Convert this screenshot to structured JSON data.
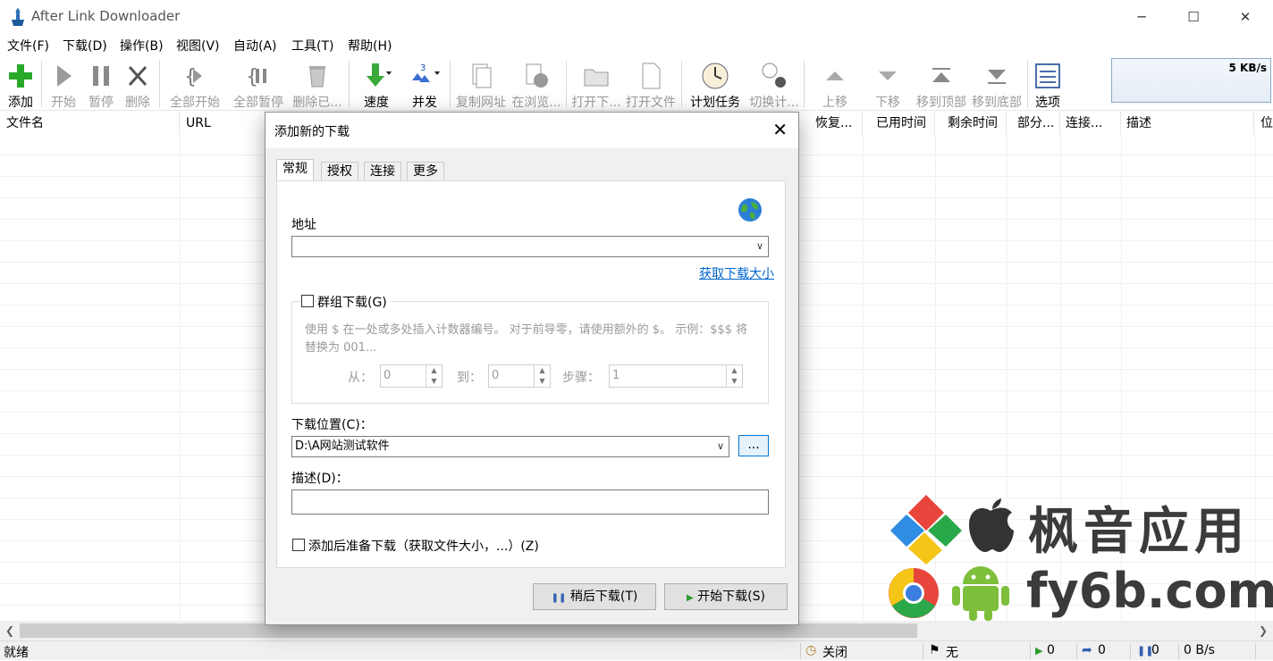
{
  "window": {
    "title": "After Link Downloader",
    "minimize": "─",
    "maximize": "☐",
    "close": "✕"
  },
  "menu": [
    "文件(F)",
    "下载(D)",
    "操作(B)",
    "视图(V)",
    "自动(A)",
    "工具(T)",
    "帮助(H)"
  ],
  "toolbar": {
    "add": "添加",
    "start": "开始",
    "pause": "暂停",
    "delete": "删除",
    "start_all": "全部开始",
    "pause_all": "全部暂停",
    "delete_done": "删除已...",
    "speed": "速度",
    "concurrent": "并发",
    "copy_url": "复制网址",
    "open_browser": "在浏览...",
    "open_folder": "打开下...",
    "open_file": "打开文件",
    "schedule": "计划任务",
    "switch_plan": "切换计...",
    "move_up": "上移",
    "move_down": "下移",
    "move_top": "移到顶部",
    "move_bottom": "移到底部",
    "options": "选项",
    "concurrent_count": "3"
  },
  "speed_indicator": "5 KB/s",
  "columns": {
    "filename": "文件名",
    "url": "URL",
    "restore": "恢复...",
    "elapsed": "已用时间",
    "remaining": "剩余时间",
    "parts": "部分...",
    "connections": "连接...",
    "description": "描述",
    "position": "位"
  },
  "statusbar": {
    "ready": "就绪",
    "schedule": "关闭",
    "limit": "无",
    "active": "0",
    "queued": "0",
    "paused": "0",
    "speed": "0 B/s"
  },
  "dialog": {
    "title": "添加新的下载",
    "tabs": [
      "常规",
      "授权",
      "连接",
      "更多"
    ],
    "address_label": "地址",
    "address_value": "",
    "get_size_link": "获取下载大小",
    "group_label": "群组下载(G)",
    "group_desc": "使用 $ 在一处或多处插入计数器编号。 对于前导零，请使用额外的 $。 示例：$$$ 将替换为 001...",
    "from_label": "从：",
    "from_value": "0",
    "to_label": "到：",
    "to_value": "0",
    "step_label": "步骤：",
    "step_value": "1",
    "location_label": "下载位置(C)：",
    "location_value": "D:\\A网站测试软件",
    "browse_label": "...",
    "desc_label": "描述(D)：",
    "desc_value": "",
    "prepare_label": "添加后准备下载（获取文件大小，...）(Z)",
    "later_button": "稍后下载(T)",
    "start_button": "开始下载(S)"
  },
  "watermark": {
    "cn": "枫音应用",
    "domain": "fy6b.com"
  }
}
